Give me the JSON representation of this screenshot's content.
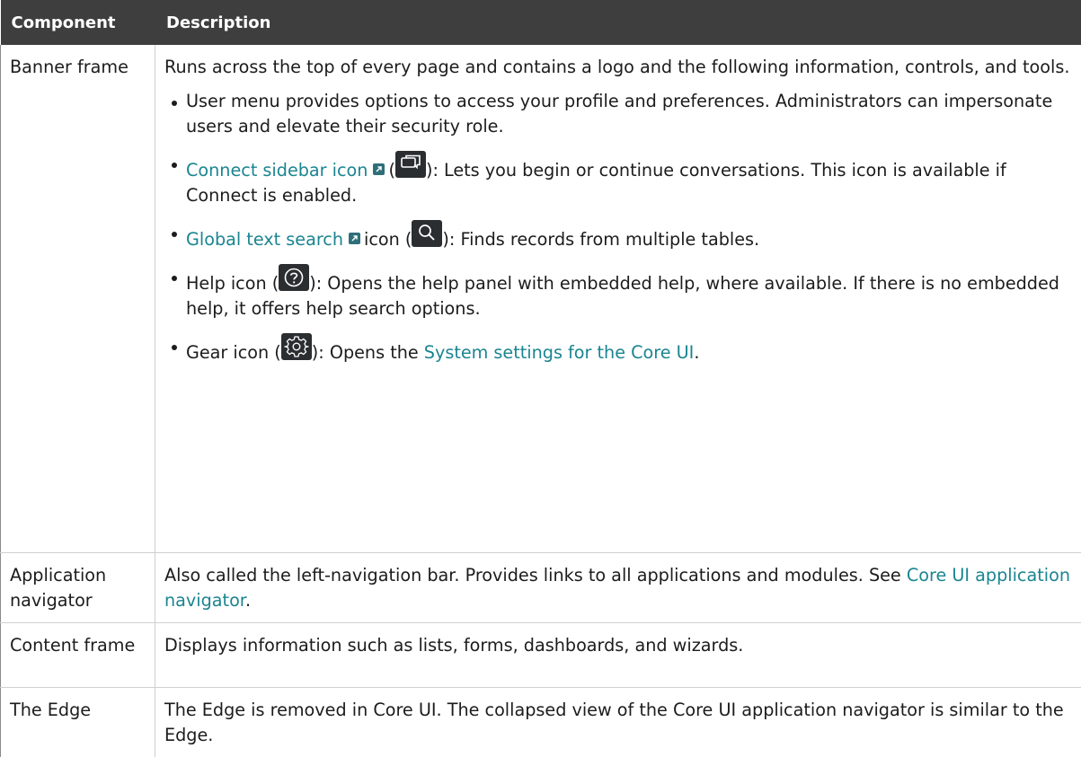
{
  "table": {
    "headers": [
      "Component",
      "Description"
    ],
    "rows": [
      {
        "component": "Banner frame",
        "intro": "Runs across the top of every page and contains a logo and the following information, controls, and tools.",
        "bullets": {
          "user_menu": "User menu provides options to access your profile and preferences. Administrators can impersonate users and elevate their security role.",
          "connect_link": "Connect sidebar icon",
          "connect_open": "(",
          "connect_rest": "): Lets you begin or continue conversations. This icon is available if Connect is enabled.",
          "search_link": "Global text search",
          "search_mid": "icon (",
          "search_rest": "): Finds records from multiple tables.",
          "help_pre": "Help icon (",
          "help_rest": "): Opens the help panel with embedded help, where available. If there is no embedded help, it offers help search options.",
          "gear_pre": "Gear icon (",
          "gear_mid": "): Opens the ",
          "gear_link": "System settings for the Core UI",
          "gear_end": "."
        }
      },
      {
        "component": "Application navigator",
        "text": "Also called the left-navigation bar. Provides links to all applications and modules. See ",
        "link": "Core UI application navigator",
        "end": "."
      },
      {
        "component": "Content frame",
        "text": "Displays information such as lists, forms, dashboards, and wizards."
      },
      {
        "component": "The Edge",
        "text": "The Edge is removed in Core UI. The collapsed view of the Core UI application navigator is similar to the Edge."
      }
    ]
  },
  "icons": {
    "connect": "chat-icon",
    "search": "search-icon",
    "help": "help-icon",
    "gear": "gear-icon",
    "external": "external-link-icon"
  },
  "colors": {
    "header_bg": "#3e3e3e",
    "link": "#1b8591",
    "icon_bg": "#2b2e30"
  }
}
